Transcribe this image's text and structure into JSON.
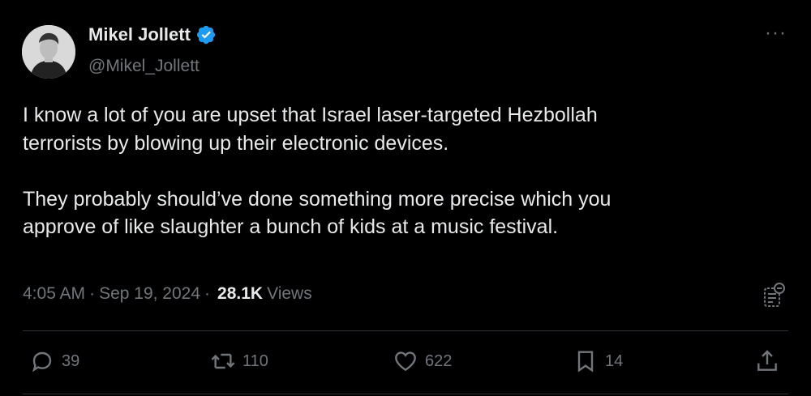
{
  "author": {
    "name": "Mikel Jollett",
    "handle": "@Mikel_Jollett",
    "verified": true,
    "avatar_icon": "profile-photo"
  },
  "tweet": {
    "text": "I know a lot of you are upset that Israel laser-targeted Hezbollah\nterrorists by blowing up their electronic devices.\n\nThey probably should’ve done something more precise which you\napprove of like slaughter a bunch of kids at a music festival.",
    "time": "4:05 AM",
    "date": "Sep 19, 2024",
    "separator": "·",
    "views_count": "28.1K",
    "views_label": "Views"
  },
  "actions": {
    "replies": "39",
    "retweets": "110",
    "likes": "622",
    "bookmarks": "14"
  },
  "colors": {
    "background": "#000000",
    "text": "#e7e9ea",
    "muted": "#71767b",
    "verified": "#1d9bf0",
    "divider": "#2f3336"
  }
}
